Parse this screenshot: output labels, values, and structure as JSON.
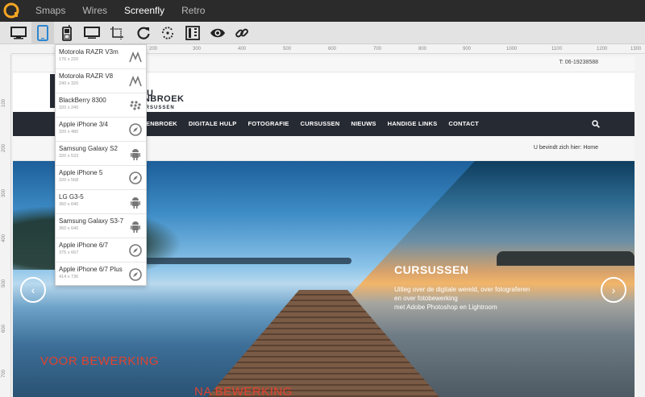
{
  "appnav": {
    "items": [
      {
        "label": "Smaps",
        "active": false
      },
      {
        "label": "Wires",
        "active": false
      },
      {
        "label": "Screenfly",
        "active": true
      },
      {
        "label": "Retro",
        "active": false
      }
    ]
  },
  "toolbar": {
    "tools": [
      "desktop-icon",
      "tablet-icon",
      "mobile-icon",
      "tv-icon",
      "crop-icon",
      "rotate-icon",
      "refresh-icon",
      "split-icon",
      "eye-icon",
      "link-icon"
    ],
    "active_tool": "tablet-icon"
  },
  "ruler": {
    "top_labels": [
      "100",
      "200",
      "300",
      "400",
      "500",
      "600",
      "700",
      "800",
      "900",
      "1000",
      "1100",
      "1200",
      "1300"
    ],
    "left_labels": [
      "100",
      "200",
      "300",
      "400",
      "500",
      "600",
      "700"
    ]
  },
  "devices": [
    {
      "name": "Motorola RAZR V3m",
      "size": "176 x 220",
      "icon": "motorola-icon"
    },
    {
      "name": "Motorola RAZR V8",
      "size": "240 x 320",
      "icon": "motorola-icon"
    },
    {
      "name": "BlackBerry 8300",
      "size": "320 x 240",
      "icon": "blackberry-icon"
    },
    {
      "name": "Apple iPhone 3/4",
      "size": "320 x 480",
      "icon": "safari-icon"
    },
    {
      "name": "Samsung Galaxy S2",
      "size": "320 x 533",
      "icon": "android-icon"
    },
    {
      "name": "Apple iPhone 5",
      "size": "320 x 568",
      "icon": "safari-icon"
    },
    {
      "name": "LG G3-5",
      "size": "360 x 640",
      "icon": "android-icon"
    },
    {
      "name": "Samsung Galaxy S3-7",
      "size": "360 x 640",
      "icon": "android-icon"
    },
    {
      "name": "Apple iPhone 6/7",
      "size": "375 x 667",
      "icon": "safari-icon"
    },
    {
      "name": "Apple iPhone 6/7 Plus",
      "size": "414 x 736",
      "icon": "safari-icon"
    }
  ],
  "site": {
    "phone": "T: 06-19238588",
    "logo_u": "U",
    "logo_name": "ENBROEK",
    "logo_sub": "CURSUSSEN",
    "nav": [
      "ENBROEK",
      "DIGITALE HULP",
      "FOTOGRAFIE",
      "CURSUSSEN",
      "NIEUWS",
      "HANDIGE LINKS",
      "CONTACT"
    ],
    "breadcrumb_prefix": "U bevindt zich hier:",
    "breadcrumb_home": "Home",
    "slide_title": "CURSUSSEN",
    "slide_text_1": "Uitleg over de digitale wereld, over fotograferen",
    "slide_text_2": "en over fotobewerking",
    "slide_text_3": "met Adobe Photoshop en Lightroom",
    "label_before": "VOOR BEWERKING",
    "label_after": "NA BEWERKING",
    "prev_arrow": "‹",
    "next_arrow": "›"
  }
}
